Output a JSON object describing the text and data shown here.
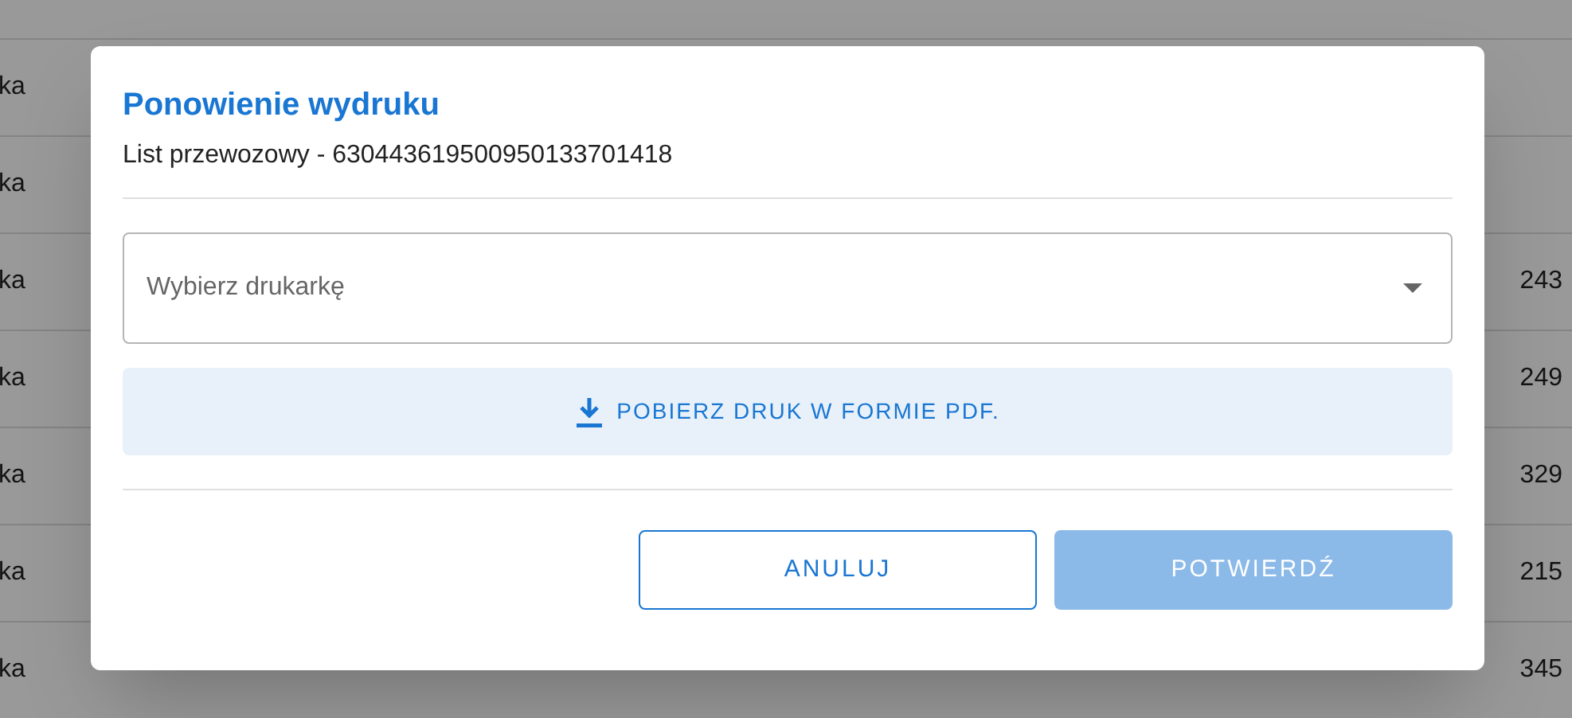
{
  "background_table": {
    "rows": [
      {
        "column_1": "ka",
        "column_2": ""
      },
      {
        "column_1": "ka",
        "column_2": ""
      },
      {
        "column_1": "ka",
        "column_2": "243"
      },
      {
        "column_1": "ka",
        "column_2": "249"
      },
      {
        "column_1": "ka",
        "column_2": "329"
      },
      {
        "column_1": "ka",
        "column_2": "215"
      },
      {
        "column_1": "ka",
        "column_2": "345"
      }
    ]
  },
  "dialog": {
    "title": "Ponowienie wydruku",
    "subtitle": "List przewozowy - 630443619500950133701418",
    "printer_select": {
      "placeholder": "Wybierz drukarkę"
    },
    "download_button": {
      "label": "POBIERZ DRUK W FORMIE PDF."
    },
    "buttons": [
      {
        "label": "ANULUJ",
        "kind": "outlined",
        "disabled": false
      },
      {
        "label": "POTWIERDŹ",
        "kind": "contained",
        "disabled": true
      }
    ]
  }
}
